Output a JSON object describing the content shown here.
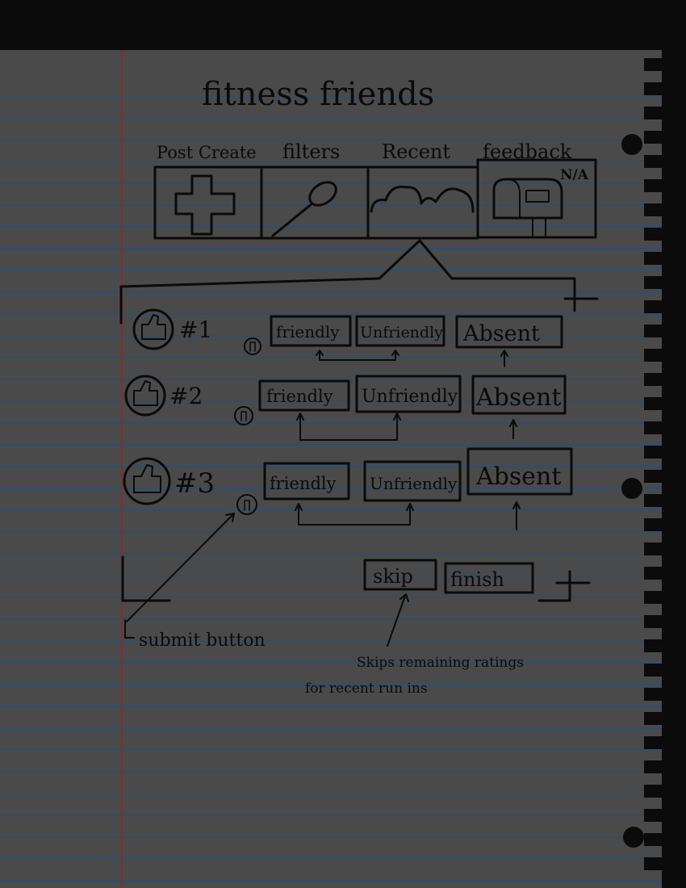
{
  "title": "fitness friends",
  "nav": {
    "tabs": [
      {
        "label": "Post Create",
        "icon": "plus-icon"
      },
      {
        "label": "filters",
        "icon": "magnifier-icon"
      },
      {
        "label": "Recent",
        "icon": "cloud-icon"
      },
      {
        "label": "feedback",
        "icon": "mailbox-icon",
        "badge": "N/A"
      }
    ]
  },
  "ratings": [
    {
      "number": "#1",
      "friendly": "friendly",
      "unfriendly": "Unfriendly",
      "absent": "Absent"
    },
    {
      "number": "#2",
      "friendly": "friendly",
      "unfriendly": "Unfriendly",
      "absent": "Absent"
    },
    {
      "number": "#3",
      "friendly": "friendly",
      "unfriendly": "Unfriendly",
      "absent": "Absent"
    }
  ],
  "actions": {
    "skip": "skip",
    "finish": "finish"
  },
  "annotations": {
    "submit": "submit button",
    "skip_note_line1": "Skips remaining ratings",
    "skip_note_line2": "for recent run ins"
  },
  "colors": {
    "paper": "#4a4a4a",
    "rule": "#2d4f6e",
    "margin": "#8a2a2a",
    "ink": "#0a0a0a"
  }
}
